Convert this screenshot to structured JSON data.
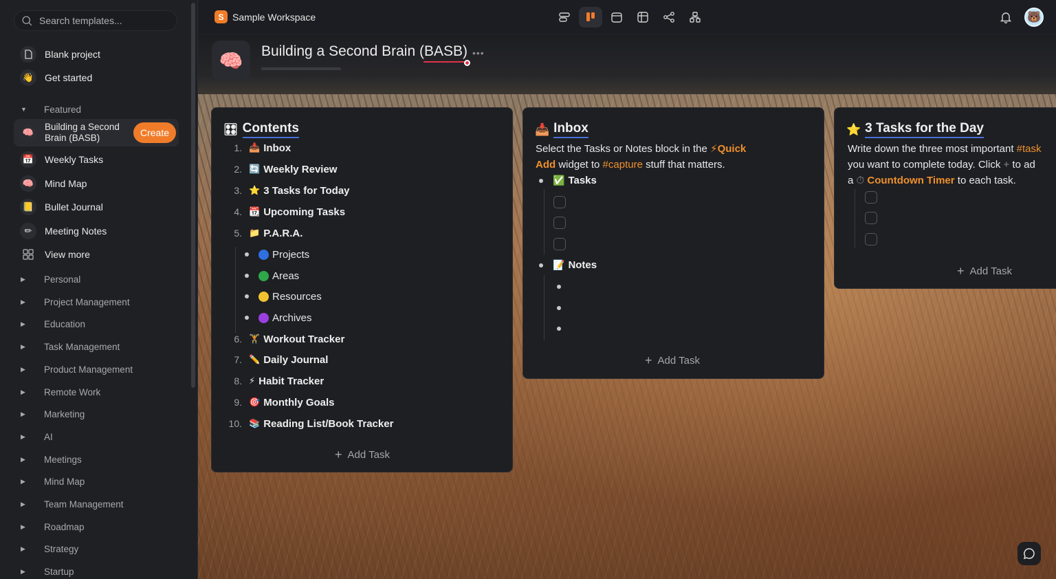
{
  "sidebar": {
    "search_placeholder": "Search templates...",
    "top_items": [
      {
        "label": "Blank project",
        "icon": "blank-project-icon"
      },
      {
        "label": "Get started",
        "icon": "wave-icon"
      }
    ],
    "featured_label": "Featured",
    "featured_items": [
      {
        "label": "Building a Second Brain (BASB)",
        "icon": "brain-icon",
        "active": true
      },
      {
        "label": "Weekly Tasks",
        "icon": "calendar-icon"
      },
      {
        "label": "Mind Map",
        "icon": "brain-icon"
      },
      {
        "label": "Bullet Journal",
        "icon": "notebook-icon"
      },
      {
        "label": "Meeting Notes",
        "icon": "pencil-icon"
      },
      {
        "label": "View more",
        "icon": "grid-icon"
      }
    ],
    "create_label": "Create",
    "categories": [
      "Personal",
      "Project Management",
      "Education",
      "Task Management",
      "Product Management",
      "Remote Work",
      "Marketing",
      "AI",
      "Meetings",
      "Mind Map",
      "Team Management",
      "Roadmap",
      "Strategy",
      "Startup"
    ]
  },
  "topbar": {
    "workspace_badge": "S",
    "workspace_name": "Sample Workspace",
    "views": [
      "list-view-icon",
      "board-view-icon",
      "calendar-view-icon",
      "table-view-icon",
      "mindmap-view-icon",
      "org-chart-view-icon"
    ],
    "active_view": "board-view-icon"
  },
  "project": {
    "title": "Building a Second Brain (BASB)",
    "more": "•••",
    "accent": "#f07c2a"
  },
  "contents": {
    "title": "Contents",
    "items": [
      {
        "num": "1.",
        "emoji": "📥",
        "label": "Inbox"
      },
      {
        "num": "2.",
        "emoji": "🔄",
        "label": "Weekly Review"
      },
      {
        "num": "3.",
        "emoji": "⭐",
        "label": "3 Tasks for Today"
      },
      {
        "num": "4.",
        "emoji": "📆",
        "label": "Upcoming Tasks"
      },
      {
        "num": "5.",
        "emoji": "📁",
        "label": "P.A.R.A."
      },
      {
        "num": "6.",
        "emoji": "🏋",
        "label": "Workout Tracker"
      },
      {
        "num": "7.",
        "emoji": "✏️",
        "label": "Daily Journal"
      },
      {
        "num": "8.",
        "emoji": "⚡",
        "label": "Habit Tracker"
      },
      {
        "num": "9.",
        "emoji": "🎯",
        "label": "Monthly Goals"
      },
      {
        "num": "10.",
        "emoji": "📚",
        "label": "Reading List/Book Tracker"
      }
    ],
    "para": [
      {
        "label": "Projects",
        "color": "#2f6fe0"
      },
      {
        "label": "Areas",
        "color": "#2ea84a"
      },
      {
        "label": "Resources",
        "color": "#f2c230"
      },
      {
        "label": "Archives",
        "color": "#9b3fe0"
      }
    ],
    "add_task": "Add Task"
  },
  "inbox": {
    "title": "Inbox",
    "desc_1": "Select the Tasks or Notes block in the ",
    "desc_quick": "Quick",
    "desc_add": "Add",
    "desc_2": " widget to ",
    "desc_tag": "#capture",
    "desc_3": " stuff that matters.",
    "tasks_label": "Tasks",
    "notes_label": "Notes",
    "add_task": "Add Task"
  },
  "today": {
    "title": "3 Tasks for the Day",
    "desc_1": "Write down the three most important ",
    "desc_tag": "#task",
    "desc_2": "you want to complete today. Click ",
    "desc_plus": "+",
    "desc_3": " to ad",
    "desc_4": "a ",
    "desc_timer": "Countdown Timer",
    "desc_5": " to each task.",
    "add_task": "Add Task"
  }
}
